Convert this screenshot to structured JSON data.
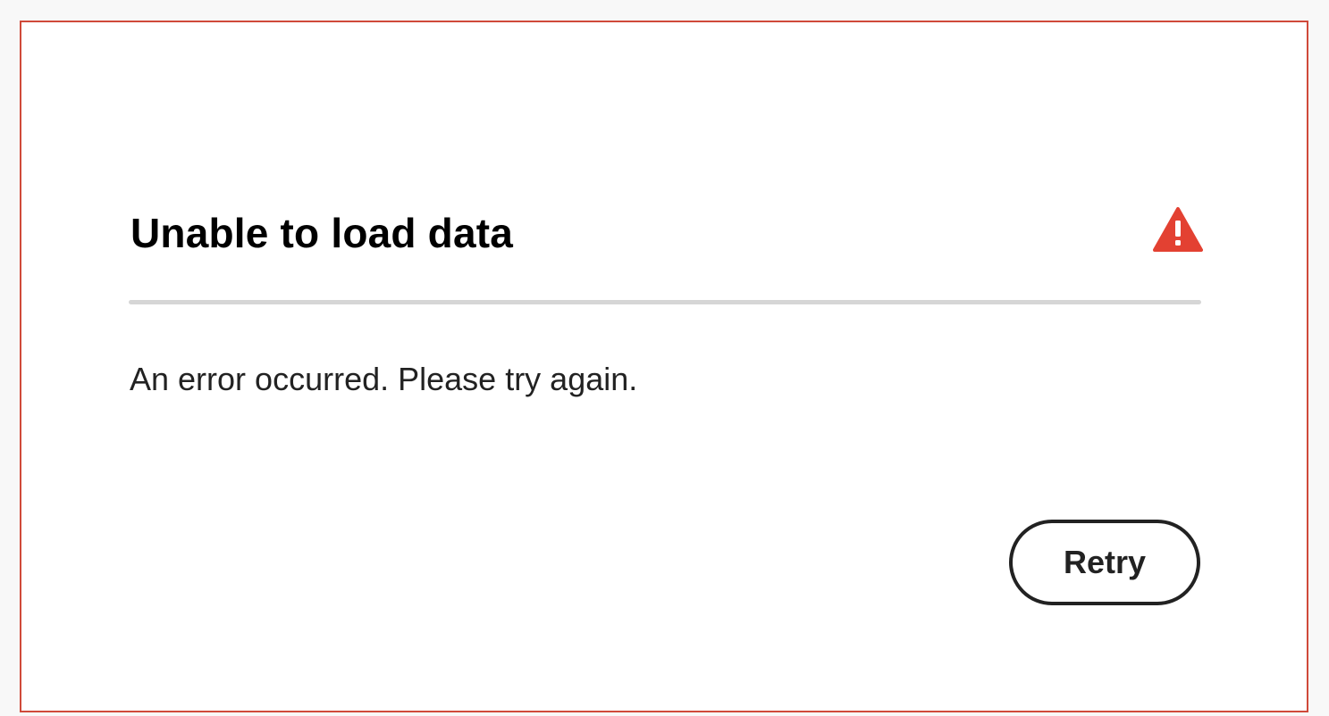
{
  "dialog": {
    "title": "Unable to load data",
    "message": "An error occurred. Please try again.",
    "retry_label": "Retry",
    "icon": "alert-icon",
    "colors": {
      "border": "#d04a3a",
      "alert": "#e34132",
      "divider": "#d6d6d6",
      "text": "#222222"
    }
  }
}
